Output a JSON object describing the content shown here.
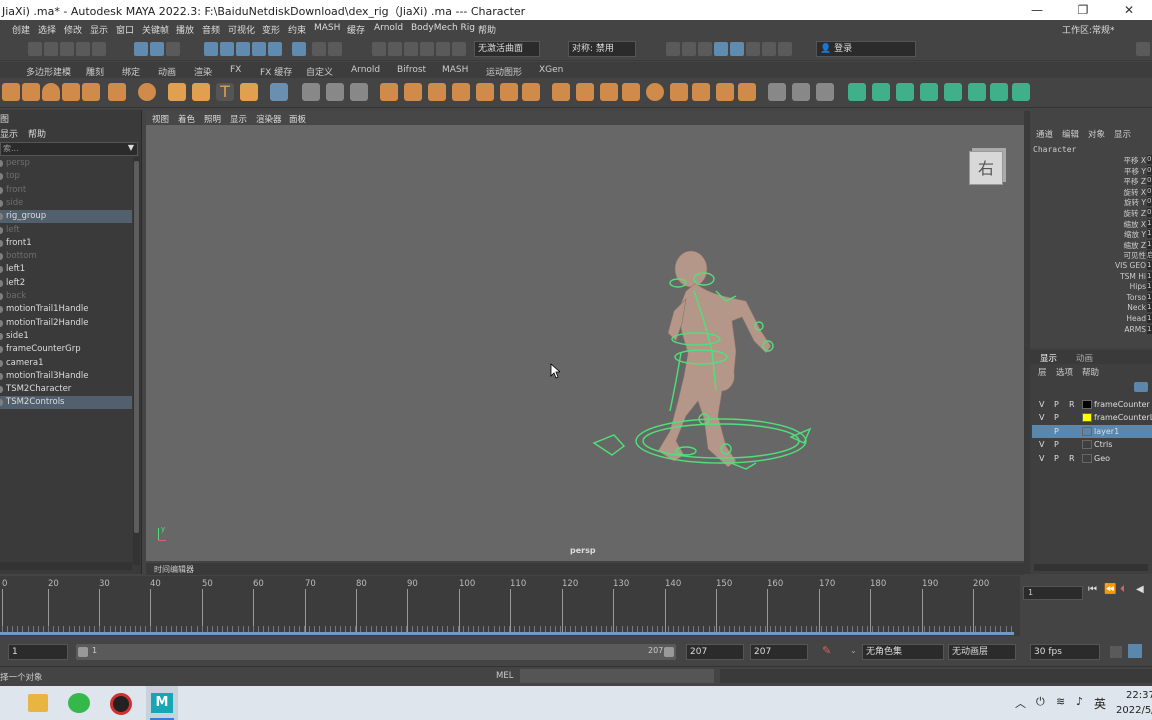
{
  "window": {
    "title": "JiaXi) .ma* - Autodesk MAYA 2022.3: F:\\BaiduNetdiskDownload\\dex_rig（JiaXi) .ma  ---   Character",
    "minimize": "—",
    "restore": "❐",
    "close": "✕"
  },
  "menubar": [
    "创建",
    "选择",
    "修改",
    "显示",
    "窗口",
    "关键帧",
    "播放",
    "音频",
    "可视化",
    "变形",
    "约束",
    "MASH",
    "缓存",
    "Arnold",
    "BodyMech Rig",
    "帮助"
  ],
  "workspace": {
    "label": "工作区:",
    "value": "常规*"
  },
  "status": {
    "live_surface": "无激活曲面",
    "symmetry": "对称: 禁用",
    "login": "登录"
  },
  "shelf_tabs": [
    "多边形建模",
    "雕刻",
    "绑定",
    "动画",
    "渲染",
    "FX",
    "FX 缓存",
    "自定义",
    "Arnold",
    "Bifrost",
    "MASH",
    "运动图形",
    "XGen"
  ],
  "outliner": {
    "menu_partial": "图",
    "menu": [
      "显示",
      "帮助"
    ],
    "filter_text": "索...",
    "items": [
      {
        "name": "persp",
        "dim": true
      },
      {
        "name": "top",
        "dim": true
      },
      {
        "name": "front",
        "dim": true
      },
      {
        "name": "side",
        "dim": true
      },
      {
        "name": "rig_group",
        "dim": false,
        "selected": true
      },
      {
        "name": "left",
        "dim": true
      },
      {
        "name": "front1",
        "dim": false
      },
      {
        "name": "bottom",
        "dim": true
      },
      {
        "name": "left1",
        "dim": false
      },
      {
        "name": "left2",
        "dim": false
      },
      {
        "name": "back",
        "dim": true
      },
      {
        "name": "motionTrail1Handle",
        "dim": false
      },
      {
        "name": "motionTrail2Handle",
        "dim": false
      },
      {
        "name": "side1",
        "dim": false
      },
      {
        "name": "frameCounterGrp",
        "dim": false
      },
      {
        "name": "camera1",
        "dim": false
      },
      {
        "name": "motionTrail3Handle",
        "dim": false
      },
      {
        "name": "TSM2Character",
        "dim": false
      },
      {
        "name": "TSM2Controls",
        "dim": false,
        "selected": true
      }
    ]
  },
  "viewport": {
    "menu": [
      "视图",
      "着色",
      "照明",
      "显示",
      "渲染器",
      "面板"
    ],
    "camera_label": "persp",
    "viewcube_face": "右",
    "axis_y": "y"
  },
  "channelbox": {
    "tabs": [
      "通道",
      "编辑",
      "对象",
      "显示"
    ],
    "object": "Character",
    "channels": [
      {
        "name": "平移 X",
        "value": "0"
      },
      {
        "name": "平移 Y",
        "value": "0"
      },
      {
        "name": "平移 Z",
        "value": "0"
      },
      {
        "name": "旋转 X",
        "value": "0"
      },
      {
        "name": "旋转 Y",
        "value": "0"
      },
      {
        "name": "旋转 Z",
        "value": "0"
      },
      {
        "name": "缩放 X",
        "value": "1"
      },
      {
        "name": "缩放 Y",
        "value": "1"
      },
      {
        "name": "缩放 Z",
        "value": "1"
      },
      {
        "name": "可见性",
        "value": "启"
      },
      {
        "name": "VIS GEO",
        "value": "1"
      },
      {
        "name": "TSM Hi",
        "value": "1"
      },
      {
        "name": "Hips",
        "value": "1"
      },
      {
        "name": "Torso",
        "value": "1"
      },
      {
        "name": "Neck",
        "value": "1"
      },
      {
        "name": "Head",
        "value": "1"
      },
      {
        "name": "ARMS",
        "value": "1"
      }
    ]
  },
  "layers": {
    "tabs": [
      "显示",
      "动画"
    ],
    "menu": [
      "层",
      "选项",
      "帮助"
    ],
    "rows": [
      {
        "v": "V",
        "p": "P",
        "r": "R",
        "color": "#000000",
        "name": "frameCounter",
        "selected": false
      },
      {
        "v": "V",
        "p": "P",
        "r": "",
        "color": "#ffff00",
        "name": "frameCounterL",
        "selected": false
      },
      {
        "v": "",
        "p": "P",
        "r": "",
        "color": "",
        "name": "layer1",
        "selected": true
      },
      {
        "v": "V",
        "p": "P",
        "r": "",
        "color": "",
        "name": "Ctrls",
        "selected": false
      },
      {
        "v": "V",
        "p": "P",
        "r": "R",
        "color": "",
        "name": "Geo",
        "selected": false
      }
    ]
  },
  "timeline": {
    "editor_tab": "时间编辑器",
    "labels": [
      "0",
      "20",
      "30",
      "40",
      "50",
      "60",
      "70",
      "80",
      "90",
      "100",
      "110",
      "120",
      "130",
      "140",
      "150",
      "160",
      "170",
      "180",
      "190",
      "200"
    ],
    "current_frame": "1"
  },
  "range": {
    "start": "1",
    "inner_start": "1",
    "inner_end": "207",
    "end_a": "207",
    "end_b": "207",
    "character_set": "无角色集",
    "anim_layer": "无动画层",
    "fps": "30 fps"
  },
  "cmdline": {
    "help_text": "择一个对象",
    "lang": "MEL"
  },
  "taskbar": {
    "time": "22:37",
    "date": "2022/5/",
    "ime": "英"
  },
  "colors": {
    "rig_green": "#4fe07a",
    "skin": "#b5978a",
    "highlight": "#5c87ad"
  }
}
